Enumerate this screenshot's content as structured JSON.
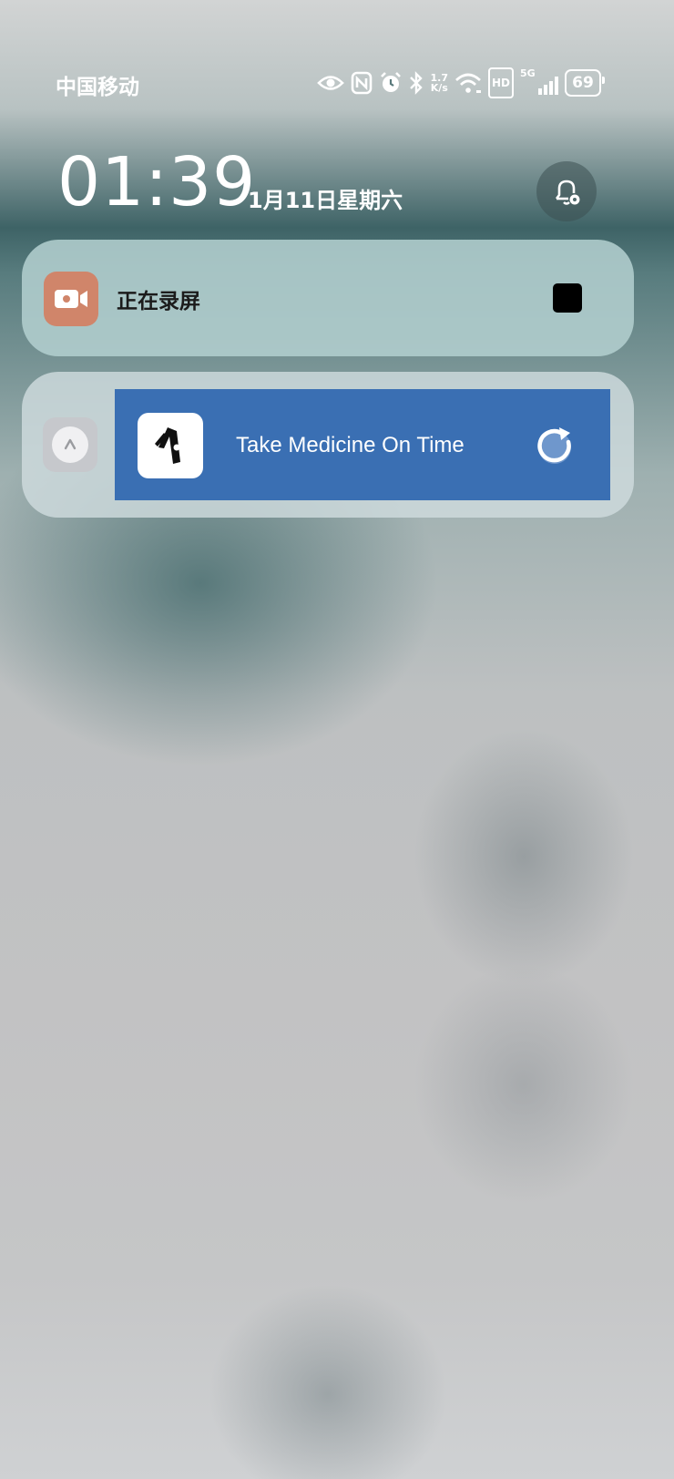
{
  "status_bar": {
    "carrier": "中国移动",
    "net_speed_value": "1.7",
    "net_speed_unit": "K/s",
    "hd_label": "HD",
    "network_label": "5G",
    "battery_level": "69",
    "icons": [
      "eye-icon",
      "nfc-icon",
      "alarm-icon",
      "bluetooth-icon",
      "wifi-icon",
      "signal-icon",
      "battery-icon"
    ]
  },
  "lock_header": {
    "time": "01:39",
    "date": "1月11日星期六",
    "bell_icon": "bell-settings-icon"
  },
  "notifications": [
    {
      "id": "screen-recording",
      "icon": "video-camera-icon",
      "label": "正在录屏",
      "action_icon": "stop-icon",
      "accent_color": "#d0856a"
    },
    {
      "id": "media",
      "collapse_icon": "chevron-up-icon",
      "app_icon": "medicine-app-icon",
      "title": "Take Medicine On Time",
      "action_icon": "refresh-icon",
      "banner_color": "#3a6fb3"
    }
  ]
}
